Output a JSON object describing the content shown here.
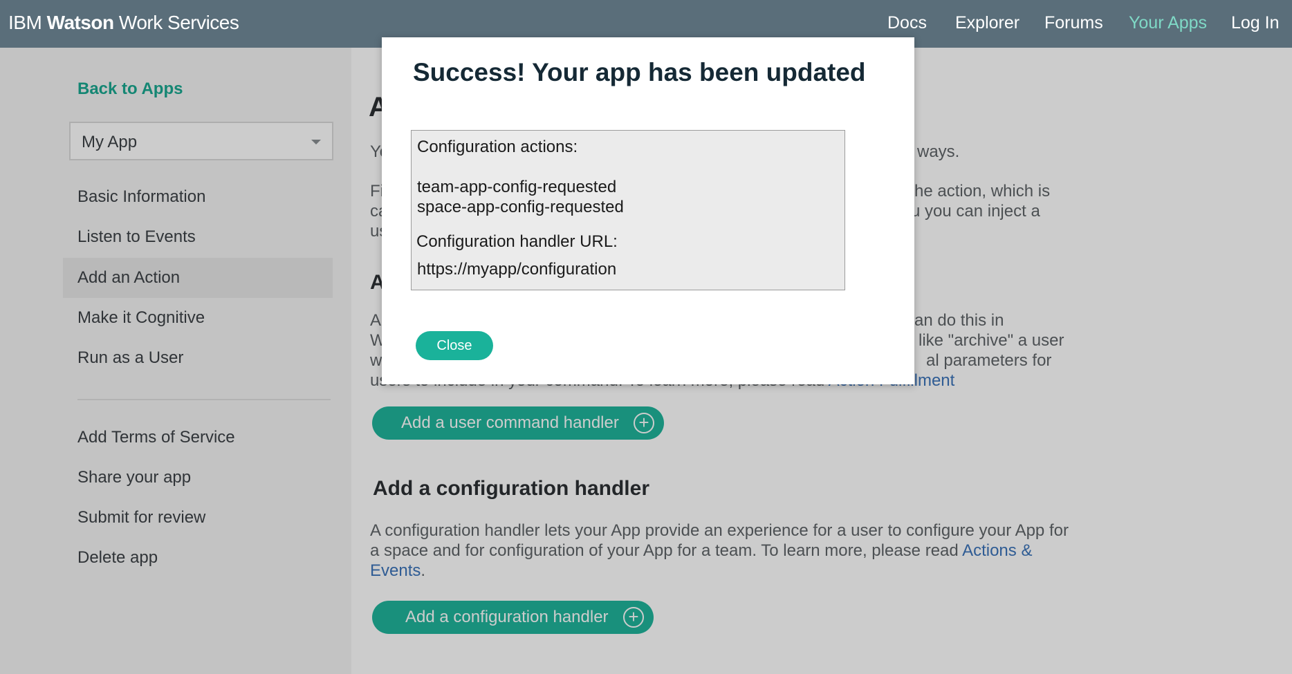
{
  "header": {
    "brand_prefix": "IBM",
    "brand_bold": "Watson",
    "brand_suffix": " Work Services",
    "nav": [
      "Docs",
      "Explorer",
      "Forums",
      "Your Apps",
      "Log In"
    ],
    "active_nav": "Your Apps"
  },
  "sidebar": {
    "back_link": "Back to Apps",
    "app_select_value": "My App",
    "items": [
      "Basic Information",
      "Listen to Events",
      "Add an Action",
      "Make it Cognitive",
      "Run as a User"
    ],
    "selected_item": "Add an Action",
    "items_secondary": [
      "Add Terms of Service",
      "Share your app",
      "Submit for review",
      "Delete app"
    ]
  },
  "main": {
    "heading_partial": "A",
    "intro_partial_left": "Yo",
    "intro_partial_right": "ways.",
    "para2_left": [
      "Fi",
      "ca",
      "us"
    ],
    "para2_right": [
      "he action, which is",
      "u you can inject a"
    ],
    "section1_heading_partial": "A",
    "para3_left": [
      "A",
      "W",
      "w"
    ],
    "para3_right": [
      "an do this in",
      "like \"archive\" a user",
      "al parameters for"
    ],
    "para3_last_line": "users to include in your command. To learn more, please read ",
    "para3_last_link": "Action Fulfillment",
    "user_command_button": "Add a user command handler",
    "config_heading": "Add a configuration handler",
    "config_text_1": "A configuration handler lets your App provide an experience for a user to configure your App for",
    "config_text_2": "a space and for configuration of your App for a team. To learn more, please read ",
    "config_link_1": "Actions &",
    "config_link_2": "Events",
    "config_text_end": ".",
    "config_button": "Add a configuration handler"
  },
  "modal": {
    "title": "Success! Your app has been updated",
    "actions_label": "Configuration actions:",
    "actions": [
      "team-app-config-requested",
      "space-app-config-requested"
    ],
    "url_label": "Configuration handler URL:",
    "url": "https://myapp/configuration",
    "close_label": "Close"
  },
  "colors": {
    "header_bg": "#5a6e7a",
    "accent": "#20b59c",
    "active_nav": "#7fd9c6",
    "link": "#3b73b9"
  }
}
